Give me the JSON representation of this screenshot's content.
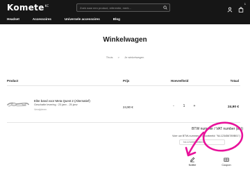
{
  "header": {
    "logo": "Komete",
    "logo_super": "KC",
    "search_placeholder": "Zoek naar een product, referentie, merk...",
    "cart_count": "1",
    "nav": [
      "Headset",
      "Accessoires",
      "Universele accessoires",
      "Blog"
    ]
  },
  "page": {
    "title": "Winkelwagen",
    "breadcrumb": [
      "Thuis",
      ">",
      "Je winkelwagen"
    ]
  },
  "table": {
    "headers": [
      "Product",
      "Prijs",
      "Hoeveelheid",
      "Totaal"
    ],
    "rows": [
      {
        "name": "Elite band voor Meta Quest 2 (Alternatief)",
        "shipping": "Geschatte levering : 23 janv - 25 janv",
        "remove": "Verwijderen",
        "price": "24,90 €",
        "qty_minus": "-",
        "qty": "1",
        "qty_plus": "+",
        "total": "24,90 €"
      }
    ]
  },
  "vat": {
    "title": "BTW nummer / VAT number (EU)",
    "hint": "Voer uw BTW-nummer in (voorbeeld: \"NL123456789B01\")",
    "placeholder": "NL123456789B01"
  },
  "actions": {
    "note": "Notitie",
    "coupon": "Coupon"
  },
  "colors": {
    "header_bg": "#161616",
    "annotation": "#e8119a"
  }
}
